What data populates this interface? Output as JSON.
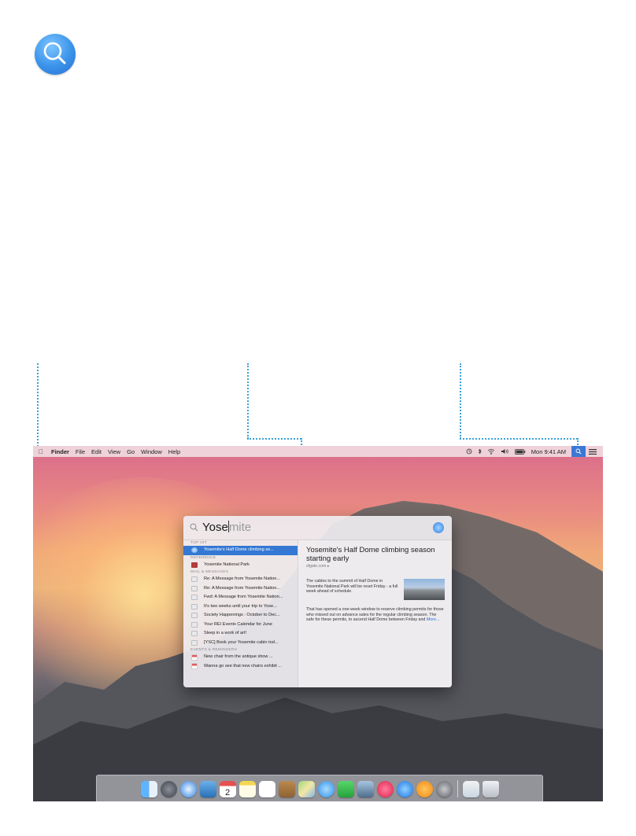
{
  "colors": {
    "accent": "#3478d4",
    "callout": "#3aa0d8",
    "selection": "#3478d4"
  },
  "menubar": {
    "apple_icon": "apple-icon",
    "items": [
      "Finder",
      "File",
      "Edit",
      "View",
      "Go",
      "Window",
      "Help"
    ],
    "status_icons": [
      "time-machine-icon",
      "bluetooth-icon",
      "wifi-icon",
      "volume-icon",
      "battery-icon"
    ],
    "clock": "Mon 9:41 AM",
    "spotlight_icon": "search-icon",
    "notification_icon": "notification-center-icon"
  },
  "spotlight": {
    "query_typed": "Yose",
    "query_completion": "mite",
    "sections": {
      "top_hit": "TOP HIT",
      "reference": "REFERENCE",
      "mail": "MAIL & MESSAGES",
      "events": "EVENTS & REMINDERS"
    },
    "top_hit": [
      "Yosemite's Half Dome climbing se..."
    ],
    "reference": [
      "Yosemite National Park"
    ],
    "mail": [
      "Re: A Message from Yosemite Nation...",
      "Re: A Message from Yosemite Nation...",
      "Fwd: A Message from Yosemite Nation...",
      "It's two weeks until your trip to Yose...",
      "Society Happenings : October to Dec...",
      "Your REI Events Calendar for June",
      "Sleep in a work of art!",
      "[YSC] Book your Yosemite cabin tod..."
    ],
    "events": [
      "New chair from the antique show ...",
      "Wanna go see that new chairs exhibit ..."
    ],
    "preview": {
      "title": "Yosemite's Half Dome climbing season starting early",
      "source": "sfgate.com",
      "paragraph1": "The cables to the summit of Half Dome in Yosemite National Park will be reset Friday - a full week ahead of schedule.",
      "paragraph2": "That has opened a one-week window to reserve climbing permits for those who missed out on advance sales for the regular climbing season. The safe for these permits, to ascend Half Dome between Friday and",
      "more": "More..."
    }
  },
  "dock": {
    "apps": [
      "finder-icon",
      "launchpad-icon",
      "safari-icon",
      "mail-icon",
      "calendar-icon",
      "notes-icon",
      "reminders-icon",
      "contacts-icon",
      "maps-icon",
      "messages-icon",
      "facetime-icon",
      "photos-icon",
      "itunes-icon",
      "app-store-icon",
      "ibooks-icon",
      "system-preferences-icon",
      "preview-icon",
      "trash-icon"
    ],
    "calendar_day": "2"
  }
}
